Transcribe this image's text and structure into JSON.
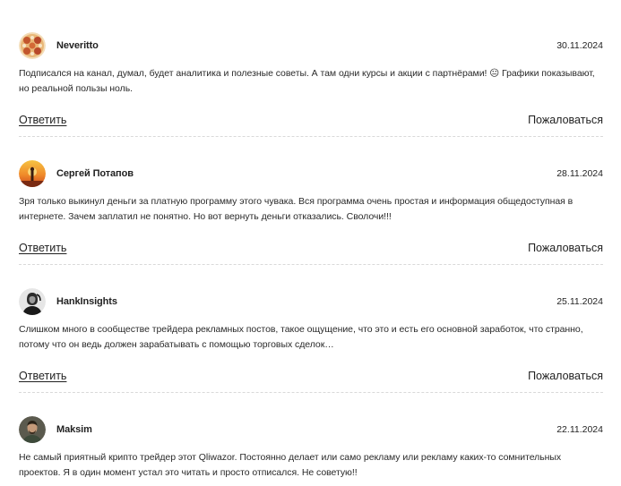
{
  "comments": [
    {
      "author": "Neveritto",
      "date": "30.11.2024",
      "text": "Подписался на канал, думал, будет аналитика и полезные советы. А там одни курсы и акции с партнёрами! 😐 Графики показывают, но реальной пользы ноль.",
      "avatar_icon": "pizza-avatar",
      "reply_label": "Ответить",
      "report_label": "Пожаловаться"
    },
    {
      "author": "Сергей Потапов",
      "date": "28.11.2024",
      "text": "Зря только выкинул деньги за платную программу этого чувака. Вся программа очень простая и информация общедоступная в интернете. Зачем заплатил не понятно. Но вот вернуть деньги отказались. Сволочи!!!",
      "avatar_icon": "sunset-avatar",
      "reply_label": "Ответить",
      "report_label": "Пожаловаться"
    },
    {
      "author": "HankInsights",
      "date": "25.11.2024",
      "text": "Слишком много в сообществе трейдера рекламных постов, такое ощущение, что это и есть его основной заработок, что странно, потому что он ведь должен зарабатывать с помощью торговых сделок…",
      "avatar_icon": "portrait-avatar",
      "reply_label": "Ответить",
      "report_label": "Пожаловаться"
    },
    {
      "author": "Maksim",
      "date": "22.11.2024",
      "text": "Не самый приятный крипто трейдер этот Qliwazor. Постоянно делает или само рекламу или рекламу каких-то сомнительных проектов. Я в один момент устал это читать и просто отписался. Не советую!!",
      "avatar_icon": "person-avatar"
    }
  ]
}
